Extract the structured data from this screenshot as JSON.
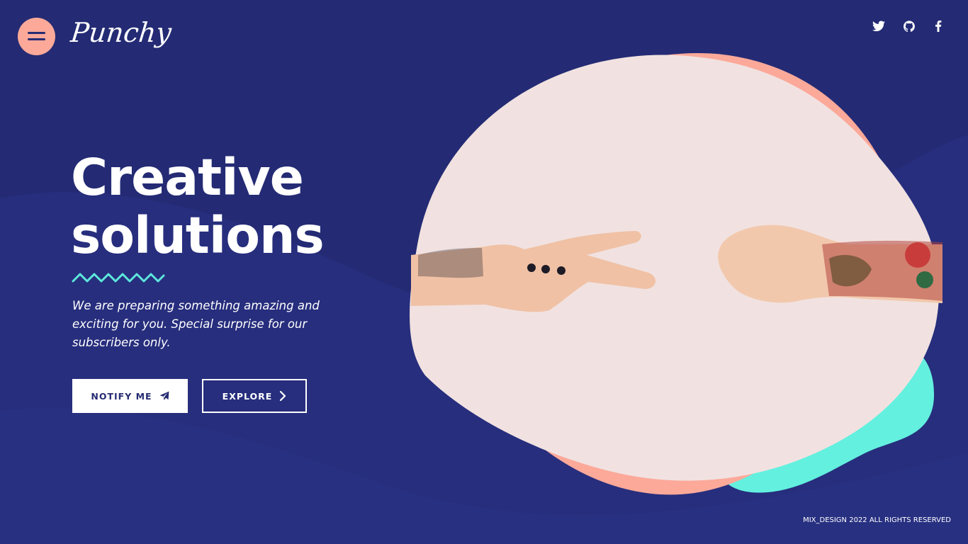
{
  "brand": {
    "logo_text": "Punchy"
  },
  "header": {
    "menu_icon": "hamburger-icon",
    "social": [
      {
        "name": "twitter",
        "icon": "twitter-icon"
      },
      {
        "name": "github",
        "icon": "github-icon"
      },
      {
        "name": "facebook",
        "icon": "facebook-icon"
      }
    ]
  },
  "hero": {
    "title_line1": "Creative",
    "title_line2": "solutions",
    "tagline_line1": "We are preparing something amazing and",
    "tagline_line2": "exciting for you. Special surprise for our",
    "tagline_line3": "subscribers only.",
    "notify_label": "NOTIFY ME",
    "notify_icon": "paper-plane-icon",
    "explore_label": "EXPLORE",
    "explore_icon": "chevron-right-icon"
  },
  "footer": {
    "copyright": "MIX_DESIGN 2022 ALL RIGHTS RESERVED"
  },
  "colors": {
    "background": "#242b74",
    "coral": "#fca99a",
    "mint": "#63f0df",
    "blush": "#f1e2e1",
    "accent_zigzag": "#5de8dc"
  }
}
